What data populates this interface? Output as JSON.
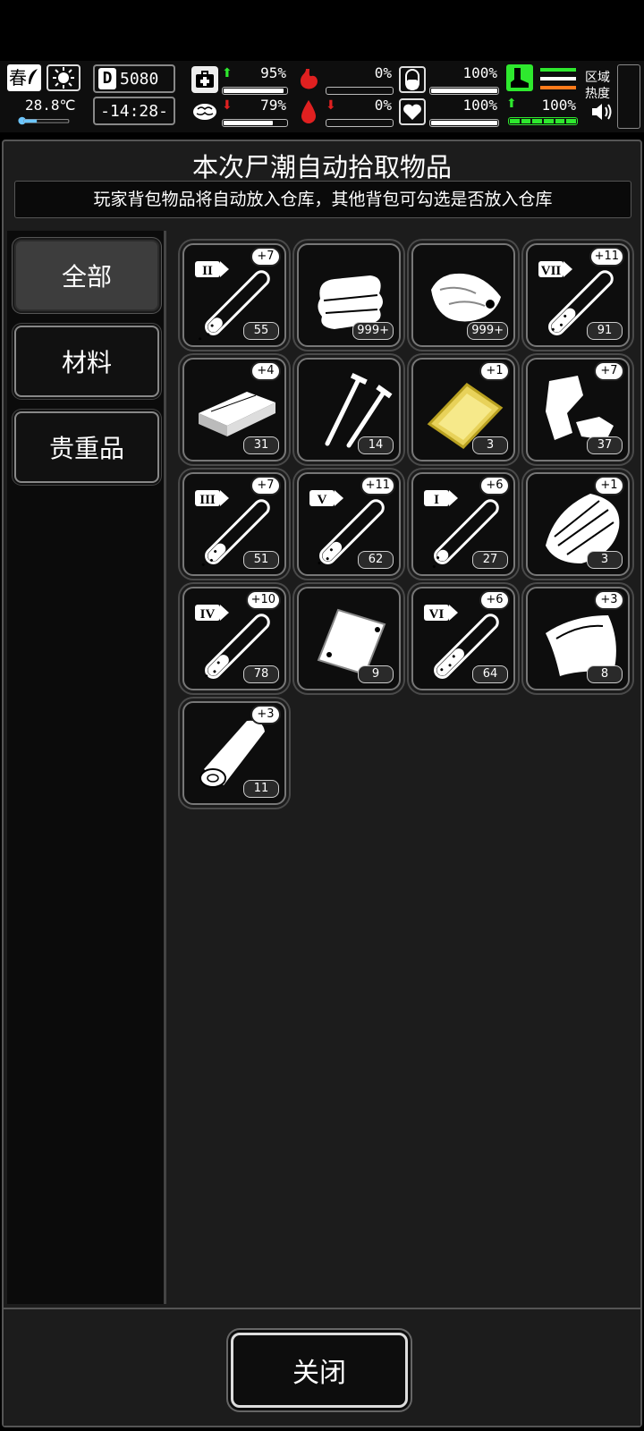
{
  "hud": {
    "season": "春",
    "temperature": "28.8℃",
    "day": "5080",
    "clock": "-14:28-",
    "stats": [
      {
        "name": "health",
        "value": "95%",
        "fill": 0.95,
        "arrow": "up"
      },
      {
        "name": "hunger",
        "value": "0%",
        "fill": 0,
        "arrow": ""
      },
      {
        "name": "armor",
        "value": "100%",
        "fill": 1.0,
        "arrow": ""
      },
      {
        "name": "infection",
        "value": "79%",
        "fill": 0.79,
        "arrow": "down"
      },
      {
        "name": "bleeding",
        "value": "0%",
        "fill": 0,
        "arrow": "down"
      },
      {
        "name": "mood",
        "value": "100%",
        "fill": 1.0,
        "arrow": ""
      }
    ],
    "stamina": "100%",
    "region_label": "区域热度"
  },
  "panel": {
    "title": "本次尸潮自动拾取物品",
    "notice": "玩家背包物品将自动放入仓库，其他背包可勾选是否放入仓库"
  },
  "categories": [
    {
      "label": "全部",
      "active": true
    },
    {
      "label": "材料",
      "active": false
    },
    {
      "label": "贵重品",
      "active": false
    }
  ],
  "items": [
    {
      "icon": "vial-II-icon",
      "bonus": "+7",
      "count": "55"
    },
    {
      "icon": "cloth-icon",
      "bonus": "",
      "count": "999+"
    },
    {
      "icon": "meat-icon",
      "bonus": "",
      "count": "999+"
    },
    {
      "icon": "vial-VII-icon",
      "bonus": "+11",
      "count": "91"
    },
    {
      "icon": "wood-plank-icon",
      "bonus": "+4",
      "count": "31"
    },
    {
      "icon": "nails-icon",
      "bonus": "",
      "count": "14"
    },
    {
      "icon": "gold-card-icon",
      "bonus": "+1",
      "count": "3"
    },
    {
      "icon": "scrap-metal-icon",
      "bonus": "+7",
      "count": "37"
    },
    {
      "icon": "vial-III-icon",
      "bonus": "+7",
      "count": "51"
    },
    {
      "icon": "vial-V-icon",
      "bonus": "+11",
      "count": "62"
    },
    {
      "icon": "vial-I-icon",
      "bonus": "+6",
      "count": "27"
    },
    {
      "icon": "bark-icon",
      "bonus": "+1",
      "count": "3"
    },
    {
      "icon": "vial-IV-icon",
      "bonus": "+10",
      "count": "78"
    },
    {
      "icon": "bag-icon",
      "bonus": "",
      "count": "9"
    },
    {
      "icon": "vial-VI-icon",
      "bonus": "+6",
      "count": "64"
    },
    {
      "icon": "leather-icon",
      "bonus": "+3",
      "count": "8"
    },
    {
      "icon": "log-icon",
      "bonus": "+3",
      "count": "11"
    }
  ],
  "footer": {
    "close_label": "关闭"
  }
}
